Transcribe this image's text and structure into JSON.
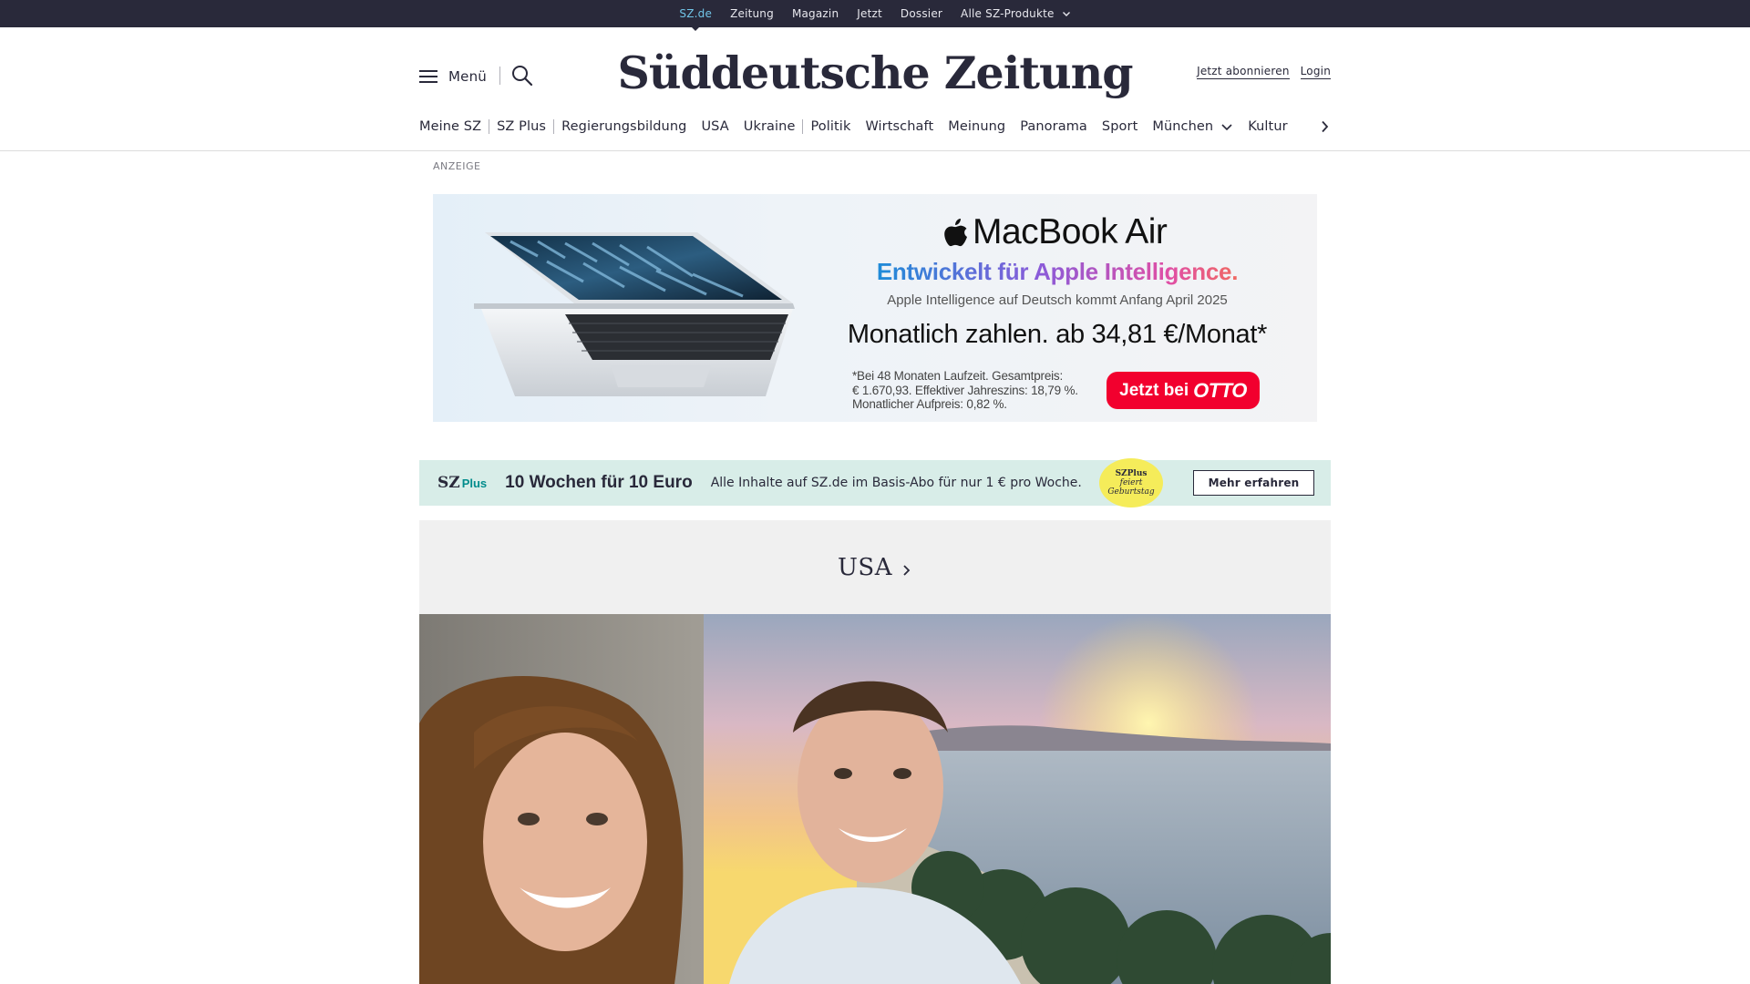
{
  "topbar": {
    "links": [
      {
        "label": "SZ.de",
        "active": true
      },
      {
        "label": "Zeitung"
      },
      {
        "label": "Magazin"
      },
      {
        "label": "Jetzt"
      },
      {
        "label": "Dossier"
      },
      {
        "label": "Alle SZ-Produkte",
        "dropdown": true
      }
    ],
    "bg_color": "#29293a",
    "active_color": "#71c5e8"
  },
  "header": {
    "menu_label": "Menü",
    "logo_text": "Süddeutsche Zeitung",
    "subscribe_label": "Jetzt abonnieren",
    "login_label": "Login",
    "icons": [
      "hamburger-icon",
      "search-icon"
    ]
  },
  "nav": {
    "items": [
      {
        "label": "Meine SZ"
      },
      {
        "label": "SZ Plus"
      },
      {
        "label": "Regierungsbildung"
      },
      {
        "label": "USA"
      },
      {
        "label": "Ukraine"
      },
      {
        "label": "Politik"
      },
      {
        "label": "Wirtschaft"
      },
      {
        "label": "Meinung"
      },
      {
        "label": "Panorama"
      },
      {
        "label": "Sport"
      },
      {
        "label": "München",
        "dropdown": true
      },
      {
        "label": "Kultur"
      }
    ],
    "next_icon": "chevron-right-icon"
  },
  "ad": {
    "label": "ANZEIGE",
    "title": "MacBook Air",
    "subtitle": "Entwickelt für Apple Intelligence.",
    "small_text": "Apple Intelligence auf Deutsch kommt Anfang April 2025",
    "price_text": "Monatlich zahlen. ab 34,81 €/Monat*",
    "fine_print": [
      "*Bei 48 Monaten Laufzeit. Gesamtpreis:",
      "€ 1.670,93.  Effektiver Jahreszins: 18,79 %.",
      "Monatlicher Aufpreis: 0,82 %."
    ],
    "cta_prefix": "Jetzt bei",
    "cta_brand": "OTTO",
    "cta_color": "#f2002e"
  },
  "promo": {
    "logo_sz": "SZ",
    "logo_plus": "Plus",
    "headline": "10 Wochen für 10 Euro",
    "text": "Alle Inhalte auf SZ.de im Basis-Abo für nur 1 € pro Woche.",
    "badge_line1": "SZPlus",
    "badge_line2": "feiert",
    "badge_line3": "Geburtstag",
    "button_label": "Mehr erfahren",
    "bg_color": "#d8ede8",
    "badge_color": "#f5ec5a"
  },
  "section": {
    "title": "USA"
  }
}
